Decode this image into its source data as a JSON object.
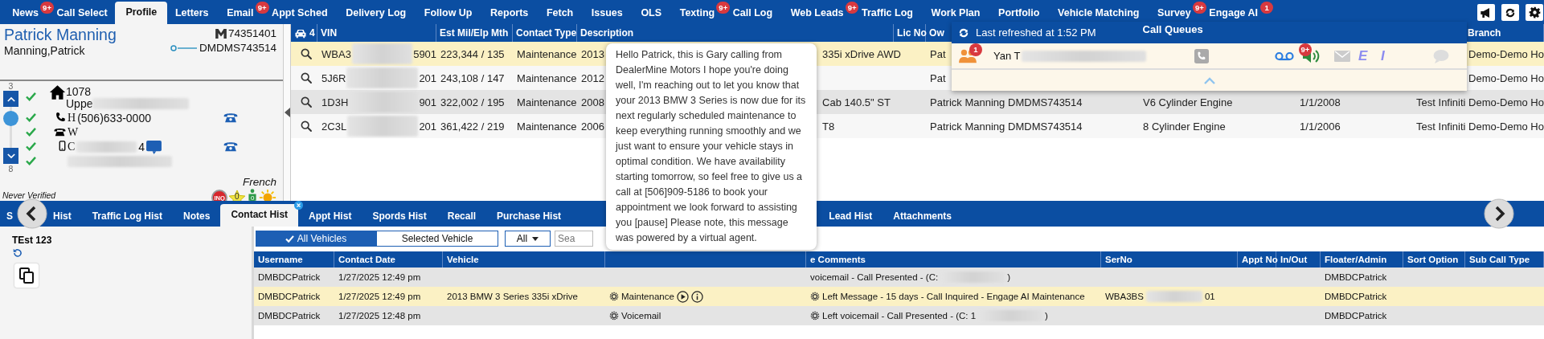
{
  "nav": {
    "tabs": [
      {
        "label": "News",
        "selected": false,
        "badge": "9+"
      },
      {
        "label": "Call Select",
        "selected": false
      },
      {
        "label": "Profile",
        "selected": true
      },
      {
        "label": "Letters",
        "selected": false
      },
      {
        "label": "Email",
        "selected": false,
        "badge": "9+"
      },
      {
        "label": "Appt Sched",
        "selected": false
      },
      {
        "label": "Delivery Log",
        "selected": false
      },
      {
        "label": "Follow Up",
        "selected": false
      },
      {
        "label": "Reports",
        "selected": false
      },
      {
        "label": "Fetch",
        "selected": false
      },
      {
        "label": "Issues",
        "selected": false
      },
      {
        "label": "OLS",
        "selected": false
      },
      {
        "label": "Texting",
        "selected": false,
        "badge": "9+"
      },
      {
        "label": "Call Log",
        "selected": false
      },
      {
        "label": "Web Leads",
        "selected": false,
        "badge": "9+"
      },
      {
        "label": "Traffic Log",
        "selected": false
      },
      {
        "label": "Work Plan",
        "selected": false
      },
      {
        "label": "Portfolio",
        "selected": false
      },
      {
        "label": "Vehicle Matching",
        "selected": false
      },
      {
        "label": "Survey",
        "selected": false,
        "badge": "9+"
      },
      {
        "label": "Engage AI",
        "selected": false,
        "badge": "1"
      }
    ]
  },
  "customer": {
    "name": "Patrick Manning",
    "sort_name": "Manning,Patrick",
    "customer_no": "74351401",
    "dms_id": "DMDMS743514",
    "range_start": "3",
    "range_end": "8",
    "contacts": [
      {
        "kind": "address",
        "verified": true,
        "line1": "1078",
        "line2": "Uppe"
      },
      {
        "kind": "home_phone",
        "verified": true,
        "type": "H",
        "value": "(506)633-0000",
        "callable": true
      },
      {
        "kind": "work_phone",
        "verified": true,
        "type": "W",
        "callable": false
      },
      {
        "kind": "mobile",
        "verified": true,
        "type": "C",
        "value": "4",
        "sms": true,
        "callable": true
      },
      {
        "kind": "email",
        "verified": true
      }
    ],
    "language": "French",
    "verification": "Never Verified",
    "inquiry_badge": "INQ",
    "star_count": "0",
    "person_count": "0"
  },
  "vehicles": {
    "count": "4",
    "columns": {
      "vin": "VIN",
      "mileage": "Est Mil/Elp Mth",
      "contact_type": "Contact Type",
      "description": "Description",
      "lic_no": "Lic No",
      "owner": "Ow",
      "branch": "Branch"
    },
    "rows": [
      {
        "selected": true,
        "vin_start": "WBA3",
        "vin_end": "5901",
        "mileage": "223,344 / 135",
        "contact_type": "Maintenance",
        "year": "2013",
        "description_end": "335i xDrive AWD",
        "owner": "Pat",
        "branch": "Demo-Demo Ho"
      },
      {
        "selected": false,
        "vin_start": "5J6R",
        "vin_end": "201",
        "mileage": "243,108 / 147",
        "contact_type": "Maintenance",
        "year": "2012",
        "owner": "Pat",
        "branch": "Demo-Demo Ho"
      },
      {
        "selected": false,
        "vin_start": "1D3H",
        "vin_end": "901",
        "mileage": "322,002 / 195",
        "contact_type": "Maintenance",
        "year": "2008",
        "description_end": "Cab 140.5\" ST",
        "owner": "Patrick Manning",
        "dms_id": "DMDMS743514",
        "engine": "V6 Cylinder Engine",
        "date": "1/1/2008",
        "dealer": "Test Infiniti",
        "branch": "Demo-Demo Ho"
      },
      {
        "selected": false,
        "vin_start": "2C3L",
        "vin_end": "201",
        "mileage": "361,422 / 219",
        "contact_type": "Maintenance",
        "year": "2006",
        "description_end": "T8",
        "owner": "Patrick Manning",
        "dms_id": "DMDMS743514",
        "engine": "8 Cylinder Engine",
        "date": "1/1/2006",
        "dealer": "Test Infiniti",
        "branch": "Demo-Demo Ho"
      }
    ]
  },
  "call_queue": {
    "refreshed": "Last refreshed at 1:52 PM",
    "title": "Call Queues",
    "agents": [
      {
        "name": "Yan T",
        "group_badge": "1",
        "voicemail_badge": "9+",
        "email_letter": "E",
        "im_letter": "I"
      }
    ]
  },
  "message_popup": {
    "text": "Hello Patrick, this is Gary calling from DealerMine Motors I hope you're doing well, I'm reaching out to let you know that your 2013 BMW 3 Series is now due for its next regularly scheduled maintenance to keep everything running smoothly and we just want to ensure your vehicle stays in optimal condition. We have availability starting tomorrow, so feel free to give us a call at [506]909-5186 to book your appointment we look forward to assisting you [pause] Please note, this message was powered by a virtual agent."
  },
  "history": {
    "tabs": [
      {
        "label_start": "S",
        "label_end": "Hist",
        "selected": false
      },
      {
        "label": "Traffic Log Hist",
        "selected": false
      },
      {
        "label": "Notes",
        "selected": false
      },
      {
        "label": "Contact Hist",
        "selected": true
      },
      {
        "label": "Appt Hist",
        "selected": false
      },
      {
        "label": "Spords Hist",
        "selected": false
      },
      {
        "label": "Recall",
        "selected": false
      },
      {
        "label": "Purchase Hist",
        "selected": false
      }
    ],
    "tabs_after": [
      {
        "label": "Lead Hist",
        "selected": false
      },
      {
        "label": "Attachments",
        "selected": false
      }
    ],
    "note": "TEst 123",
    "filters": [
      {
        "label": "All Vehicles",
        "selected": true
      },
      {
        "label": "Selected Vehicle",
        "selected": false
      }
    ],
    "dropdown": "All",
    "search_placeholder": "Sea",
    "columns": {
      "username": "Username",
      "contact_date": "Contact Date",
      "vehicle": "Vehicle",
      "comments": "e Comments",
      "ser_no": "SerNo",
      "appt_no": "Appt No",
      "in_out": "In/Out",
      "floater": "Floater/Admin",
      "sort_option": "Sort Option",
      "sub_call_type": "Sub Call Type"
    },
    "rows": [
      {
        "selected": false,
        "username": "DMBDCPatrick",
        "contact_date": "1/27/2025 12:49 pm",
        "comment_icon": false,
        "comments": "voicemail - Call Presented - (C:",
        "comments_end": ")",
        "floater": "DMBDCPatrick"
      },
      {
        "selected": true,
        "username": "DMBDCPatrick",
        "contact_date": "1/27/2025 12:49 pm",
        "vehicle": "2013 BMW 3 Series 335i xDrive",
        "type": "Maintenance",
        "playable": true,
        "comment_icon": true,
        "comments": "Left Message - 15 days - Call Inquired - Engage AI Maintenance",
        "ser_no": "WBA3BS",
        "ser_no_end": "01",
        "floater": "DMBDCPatrick"
      },
      {
        "selected": false,
        "username": "DMBDCPatrick",
        "contact_date": "1/27/2025 12:48 pm",
        "type": "Voicemail",
        "playable": false,
        "comment_icon": true,
        "comments": "Left voicemail - Call Presented - (C: 1",
        "comments_end": ")",
        "floater": "DMBDCPatrick"
      }
    ]
  }
}
